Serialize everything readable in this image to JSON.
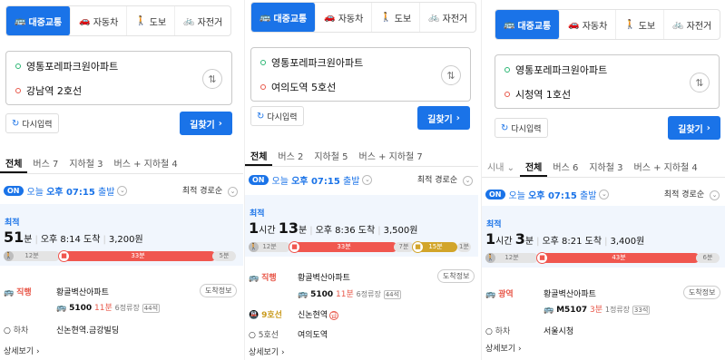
{
  "modes": [
    "대중교통",
    "자동차",
    "도보",
    "자전거"
  ],
  "panels": [
    {
      "origin": "영통포레파크원아파트",
      "destination": "강남역 2호선",
      "reset": "다시입력",
      "search": "길찾기",
      "tabs": [
        "전체",
        "버스 7",
        "지하철 3",
        "버스 + 지하철 4"
      ],
      "on": "ON",
      "depart_prefix": "오늘",
      "depart_time": "오후 07:15",
      "depart_suffix": "출발",
      "sort": "최적 경로순",
      "best": "최적",
      "duration_num": "51",
      "duration_unit": "분",
      "arrive": "오후 8:14 도착",
      "fare": "3,200원",
      "bar": {
        "walk1": "12분",
        "ride": "33분",
        "walk2": "5분"
      },
      "step1": {
        "label": "직행",
        "stop": "황골벽산아파트",
        "info": "도착정보",
        "bus": "5100",
        "mins": "11분",
        "stops": "6정류장",
        "seat": "44석"
      },
      "step2": {
        "label": "하차",
        "stop": "신논현역.금강빌딩"
      },
      "detail": "상세보기"
    },
    {
      "origin": "영통포레파크원아파트",
      "destination": "여의도역 5호선",
      "reset": "다시입력",
      "search": "길찾기",
      "tabs": [
        "전체",
        "버스 2",
        "지하철 5",
        "버스 + 지하철 7"
      ],
      "on": "ON",
      "depart_prefix": "오늘",
      "depart_time": "오후 07:15",
      "depart_suffix": "출발",
      "sort": "최적 경로순",
      "best": "최적",
      "duration_hour": "1",
      "duration_hour_unit": "시간",
      "duration_num": "13",
      "duration_unit": "분",
      "arrive": "오후 8:36 도착",
      "fare": "3,500원",
      "bar": {
        "walk1": "12분",
        "ride": "33분",
        "walk2": "7분",
        "sub": "15분",
        "walk3": "1분"
      },
      "step1": {
        "label": "직행",
        "stop": "황골벽산아파트",
        "info": "도착정보",
        "bus": "5100",
        "mins": "11분",
        "stops": "6정류장",
        "seat": "44석"
      },
      "step2": {
        "label": "9호선",
        "stop": "신논현역",
        "badge": "급"
      },
      "step3": {
        "label": "5호선",
        "stop": "여의도역"
      },
      "detail": "상세보기"
    },
    {
      "origin": "영통포레파크원아파트",
      "destination": "시청역 1호선",
      "reset": "다시입력",
      "search": "길찾기",
      "tabs": [
        "시내",
        "전체",
        "버스 6",
        "지하철 3",
        "버스 + 지하철 4"
      ],
      "on": "ON",
      "depart_prefix": "오늘",
      "depart_time": "오후 07:15",
      "depart_suffix": "출발",
      "sort": "최적 경로순",
      "best": "최적",
      "duration_hour": "1",
      "duration_hour_unit": "시간",
      "duration_num": "3",
      "duration_unit": "분",
      "arrive": "오후 8:21 도착",
      "fare": "3,400원",
      "bar": {
        "walk1": "12분",
        "ride": "43분",
        "walk2": "6분"
      },
      "step1": {
        "label": "광역",
        "stop": "황골벽산아파트",
        "info": "도착정보",
        "bus": "M5107",
        "mins": "3분",
        "stops": "1정류장",
        "seat": "33석"
      },
      "step2": {
        "label": "하차",
        "stop": "서울시청"
      },
      "detail": "상세보기"
    }
  ]
}
